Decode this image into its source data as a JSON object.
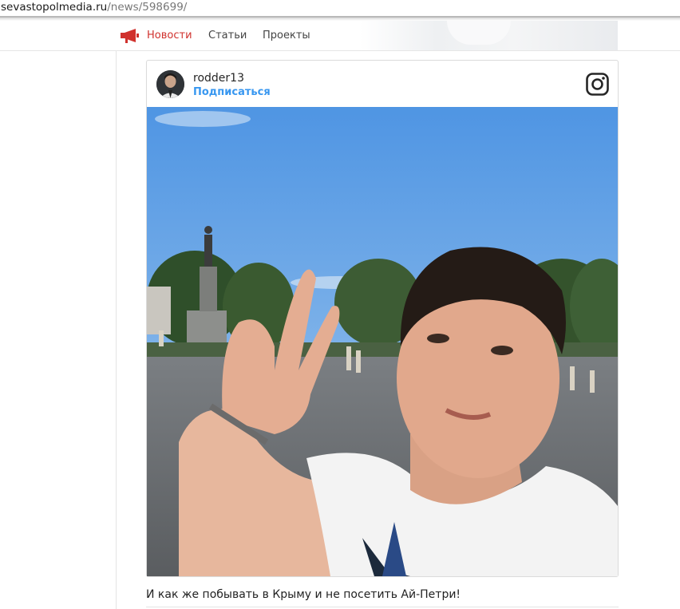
{
  "address_bar": {
    "host": "sevastopolmedia.ru",
    "path": "/news/598699/"
  },
  "nav": {
    "items": [
      {
        "label": "Новости",
        "active": true
      },
      {
        "label": "Статьи",
        "active": false
      },
      {
        "label": "Проекты",
        "active": false
      }
    ],
    "logo_icon": "megaphone-icon"
  },
  "instagram_post": {
    "username": "rodder13",
    "follow_label": "Подписаться",
    "logo_icon": "instagram-icon",
    "photo_icon": "selfie-photo"
  },
  "caption": "И как же побывать в Крыму и не посетить Ай-Петри!",
  "colors": {
    "accent": "#d0312d",
    "follow_blue": "#3897f0",
    "sky": "#5d9ce0"
  }
}
